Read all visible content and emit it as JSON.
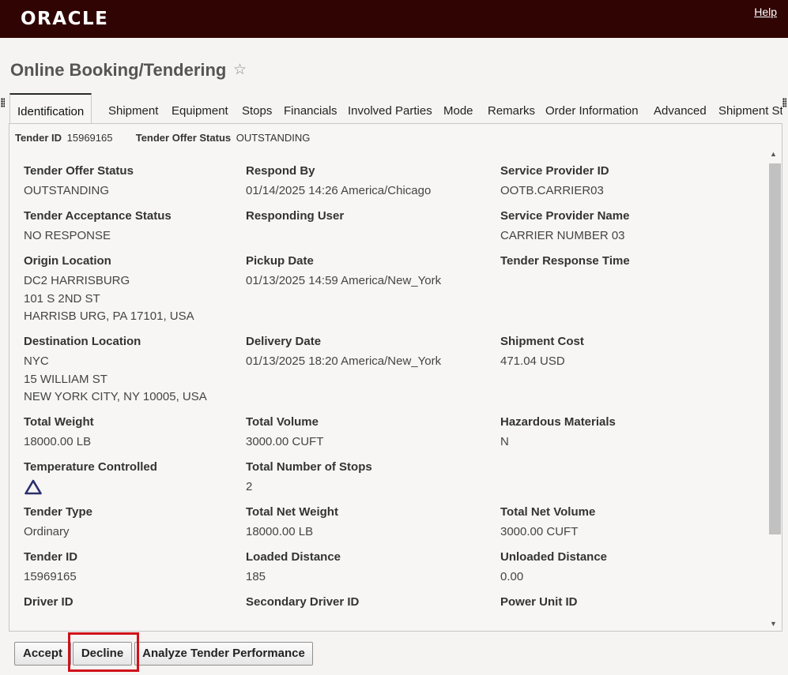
{
  "header": {
    "logo": "ORACLE",
    "help": "Help"
  },
  "page": {
    "title": "Online Booking/Tendering",
    "favorite_icon": "star-icon"
  },
  "tabs": [
    {
      "label": "Identification",
      "active": true
    },
    {
      "label": "Shipment"
    },
    {
      "label": "Equipment"
    },
    {
      "label": "Stops"
    },
    {
      "label": "Financials"
    },
    {
      "label": "Involved Parties"
    },
    {
      "label": "Mode"
    },
    {
      "label": "Remarks"
    },
    {
      "label": "Order Information"
    },
    {
      "label": "Advanced"
    },
    {
      "label": "Shipment St"
    }
  ],
  "summary": {
    "tender_id_label": "Tender ID",
    "tender_id_value": "15969165",
    "status_label": "Tender Offer Status",
    "status_value": "OUTSTANDING"
  },
  "fields": {
    "tender_offer_status": {
      "label": "Tender Offer Status",
      "value": "OUTSTANDING"
    },
    "respond_by": {
      "label": "Respond By",
      "value": "01/14/2025 14:26 America/Chicago"
    },
    "service_provider_id": {
      "label": "Service Provider ID",
      "value": "OOTB.CARRIER03"
    },
    "tender_acceptance_status": {
      "label": "Tender Acceptance Status",
      "value": "NO RESPONSE"
    },
    "responding_user": {
      "label": "Responding User",
      "value": ""
    },
    "service_provider_name": {
      "label": "Service Provider Name",
      "value": "CARRIER NUMBER 03"
    },
    "origin_location": {
      "label": "Origin Location",
      "line1": "DC2 HARRISBURG",
      "line2": "101 S 2ND ST",
      "line3": "HARRISB URG, PA 17101, USA"
    },
    "pickup_date": {
      "label": "Pickup Date",
      "value": "01/13/2025 14:59 America/New_York"
    },
    "tender_response_time": {
      "label": "Tender Response Time",
      "value": ""
    },
    "destination_location": {
      "label": "Destination Location",
      "line1": "NYC",
      "line2": "15 WILLIAM ST",
      "line3": "NEW YORK CITY, NY 10005, USA"
    },
    "delivery_date": {
      "label": "Delivery Date",
      "value": "01/13/2025 18:20 America/New_York"
    },
    "shipment_cost": {
      "label": "Shipment Cost",
      "value": "471.04 USD"
    },
    "total_weight": {
      "label": "Total Weight",
      "value": "18000.00 LB"
    },
    "total_volume": {
      "label": "Total Volume",
      "value": "3000.00 CUFT"
    },
    "hazardous_materials": {
      "label": "Hazardous Materials",
      "value": "N"
    },
    "temperature_controlled": {
      "label": "Temperature Controlled",
      "icon": "triangle-warning-icon"
    },
    "total_number_of_stops": {
      "label": "Total Number of Stops",
      "value": "2"
    },
    "tender_type": {
      "label": "Tender Type",
      "value": "Ordinary"
    },
    "total_net_weight": {
      "label": "Total Net Weight",
      "value": "18000.00 LB"
    },
    "total_net_volume": {
      "label": "Total Net Volume",
      "value": "3000.00 CUFT"
    },
    "tender_id": {
      "label": "Tender ID",
      "value": "15969165"
    },
    "loaded_distance": {
      "label": "Loaded Distance",
      "value": "185"
    },
    "unloaded_distance": {
      "label": "Unloaded Distance",
      "value": "0.00"
    },
    "driver_id": {
      "label": "Driver ID",
      "value": ""
    },
    "secondary_driver_id": {
      "label": "Secondary Driver ID",
      "value": ""
    },
    "power_unit_id": {
      "label": "Power Unit ID",
      "value": ""
    }
  },
  "buttons": {
    "accept": "Accept",
    "decline": "Decline",
    "analyze": "Analyze Tender Performance"
  },
  "colors": {
    "header_bg": "#310404",
    "highlight": "#d1111b",
    "icon_navy": "#2a2f6e"
  }
}
